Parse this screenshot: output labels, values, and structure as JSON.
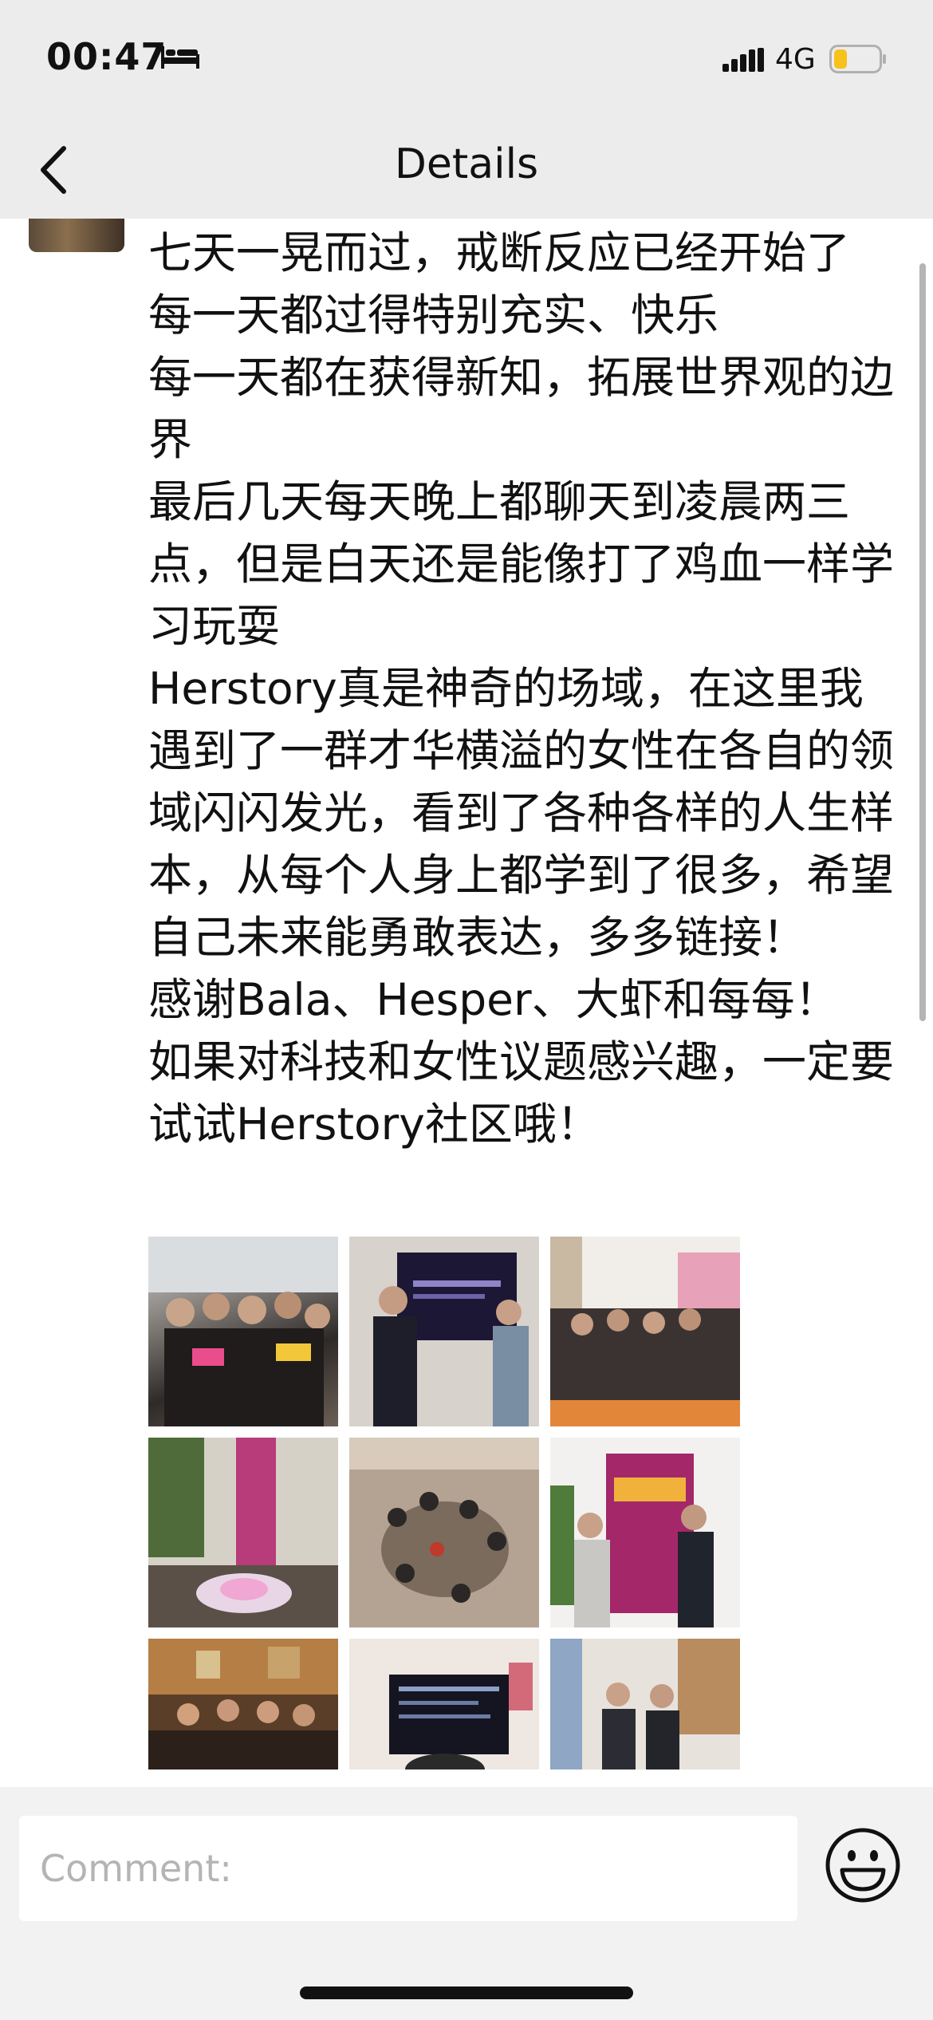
{
  "status_bar": {
    "time": "00:47",
    "network": "4G",
    "battery_color": "#f7c21b"
  },
  "header": {
    "title": "Details",
    "back_icon": "chevron-left-icon"
  },
  "post": {
    "text": "七天一晃而过，戒断反应已经开始了\n每一天都过得特别充实、快乐\n每一天都在获得新知，拓展世界观的边界\n最后几天每天晚上都聊天到凌晨两三点，但是白天还是能像打了鸡血一样学习玩耍\nHerstory真是神奇的场域，在这里我遇到了一群才华横溢的女性在各自的领域闪闪发光，看到了各种各样的人生样本，从每个人身上都学到了很多，希望自己未来能勇敢表达，多多链接！\n感谢Bala、Hesper、大虾和每每！\n如果对科技和女性议题感兴趣，一定要试试Herstory社区哦！",
    "photo_count": 9
  },
  "comment": {
    "placeholder": "Comment:",
    "emoji_icon": "smiley-face-icon"
  }
}
